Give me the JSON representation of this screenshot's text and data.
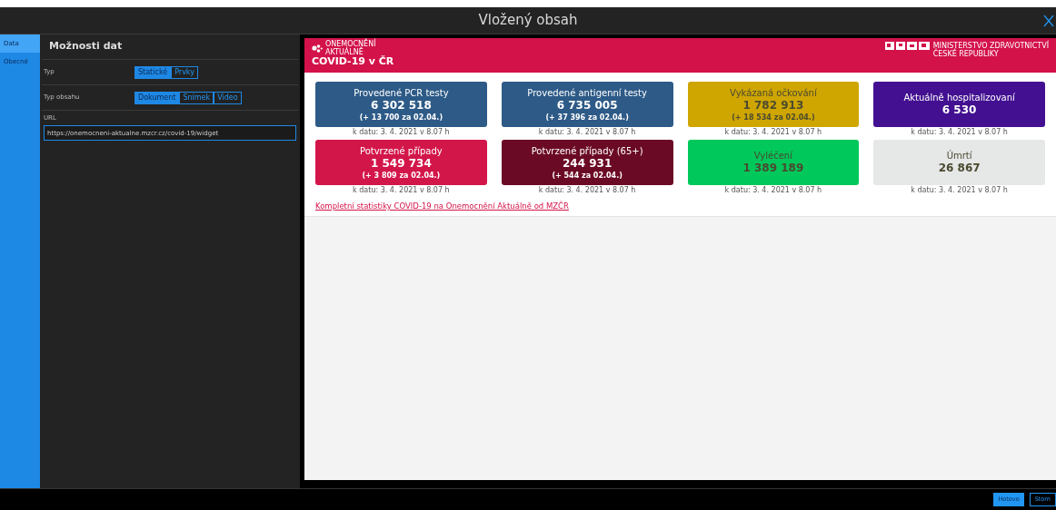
{
  "window": {
    "title": "Vložený obsah"
  },
  "side_tabs": [
    {
      "label": "Data",
      "selected": true
    },
    {
      "label": "Obecné",
      "selected": false
    }
  ],
  "panel": {
    "title": "Možnosti dat",
    "rows": [
      {
        "label": "Typ",
        "options": [
          {
            "label": "Statické",
            "selected": true
          },
          {
            "label": "Prvky",
            "selected": false
          }
        ]
      },
      {
        "label": "Typ obsahu",
        "options": [
          {
            "label": "Dokument",
            "selected": true
          },
          {
            "label": "Snímek",
            "selected": false
          },
          {
            "label": "Video",
            "selected": false
          }
        ]
      }
    ],
    "url": {
      "label": "URL",
      "value": "https://onemocneni-aktualne.mzcr.cz/covid-19/widget"
    }
  },
  "widget": {
    "logo_text": [
      "ONEMOCNĚNÍ",
      "AKTUÁLNĚ"
    ],
    "title": "COVID-19 v ČR",
    "ministry_text": [
      "MINISTERSTVO ZDRAVOTNICTVÍ",
      "ČESKÉ REPUBLIKY"
    ],
    "cards": [
      {
        "label": "Provedené PCR testy",
        "value": "6 302 518",
        "delta": "(+ 13 700 za 02.04.)",
        "date": "k datu: 3. 4. 2021 v 8.07 h",
        "color": "#2d5a87",
        "dark_text": false
      },
      {
        "label": "Provedené antigenní testy",
        "value": "6 735 005",
        "delta": "(+ 37 396 za 02.04.)",
        "date": "k datu: 3. 4. 2021 v 8.07 h",
        "color": "#2d5a87",
        "dark_text": false
      },
      {
        "label": "Vykázaná očkování",
        "value": "1 782 913",
        "delta": "(+ 18 534 za 02.04.)",
        "date": "k datu: 3. 4. 2021 v 8.07 h",
        "color": "#cfa500",
        "dark_text": true
      },
      {
        "label": "Aktuálně hospitalizovaní",
        "value": "6 530",
        "date": "k datu: 3. 4. 2021 v 8.07 h",
        "color": "#421090",
        "dark_text": false
      },
      {
        "label": "Potvrzené případy",
        "value": "1 549 734",
        "delta": "(+ 3 809 za 02.04.)",
        "date": "k datu: 3. 4. 2021 v 8.07 h",
        "color": "#d3164a",
        "dark_text": false
      },
      {
        "label": "Potvrzené případy (65+)",
        "value": "244 931",
        "delta": "(+ 544 za 02.04.)",
        "date": "k datu: 3. 4. 2021 v 8.07 h",
        "color": "#6b0a25",
        "dark_text": false
      },
      {
        "label": "Vyléčení",
        "value": "1 389 189",
        "date": "k datu: 3. 4. 2021 v 8.07 h",
        "color": "#00c85a",
        "dark_text": true
      },
      {
        "label": "Úmrtí",
        "value": "26 867",
        "date": "k datu: 3. 4. 2021 v 8.07 h",
        "color": "#e6e7e7",
        "dark_text": true
      }
    ],
    "link": "Kompletní statistiky COVID-19 na Onemocnění Aktuálně od MZČR"
  },
  "buttons": [
    {
      "label": "Hotovo",
      "primary": true
    },
    {
      "label": "Storn",
      "primary": false
    }
  ]
}
